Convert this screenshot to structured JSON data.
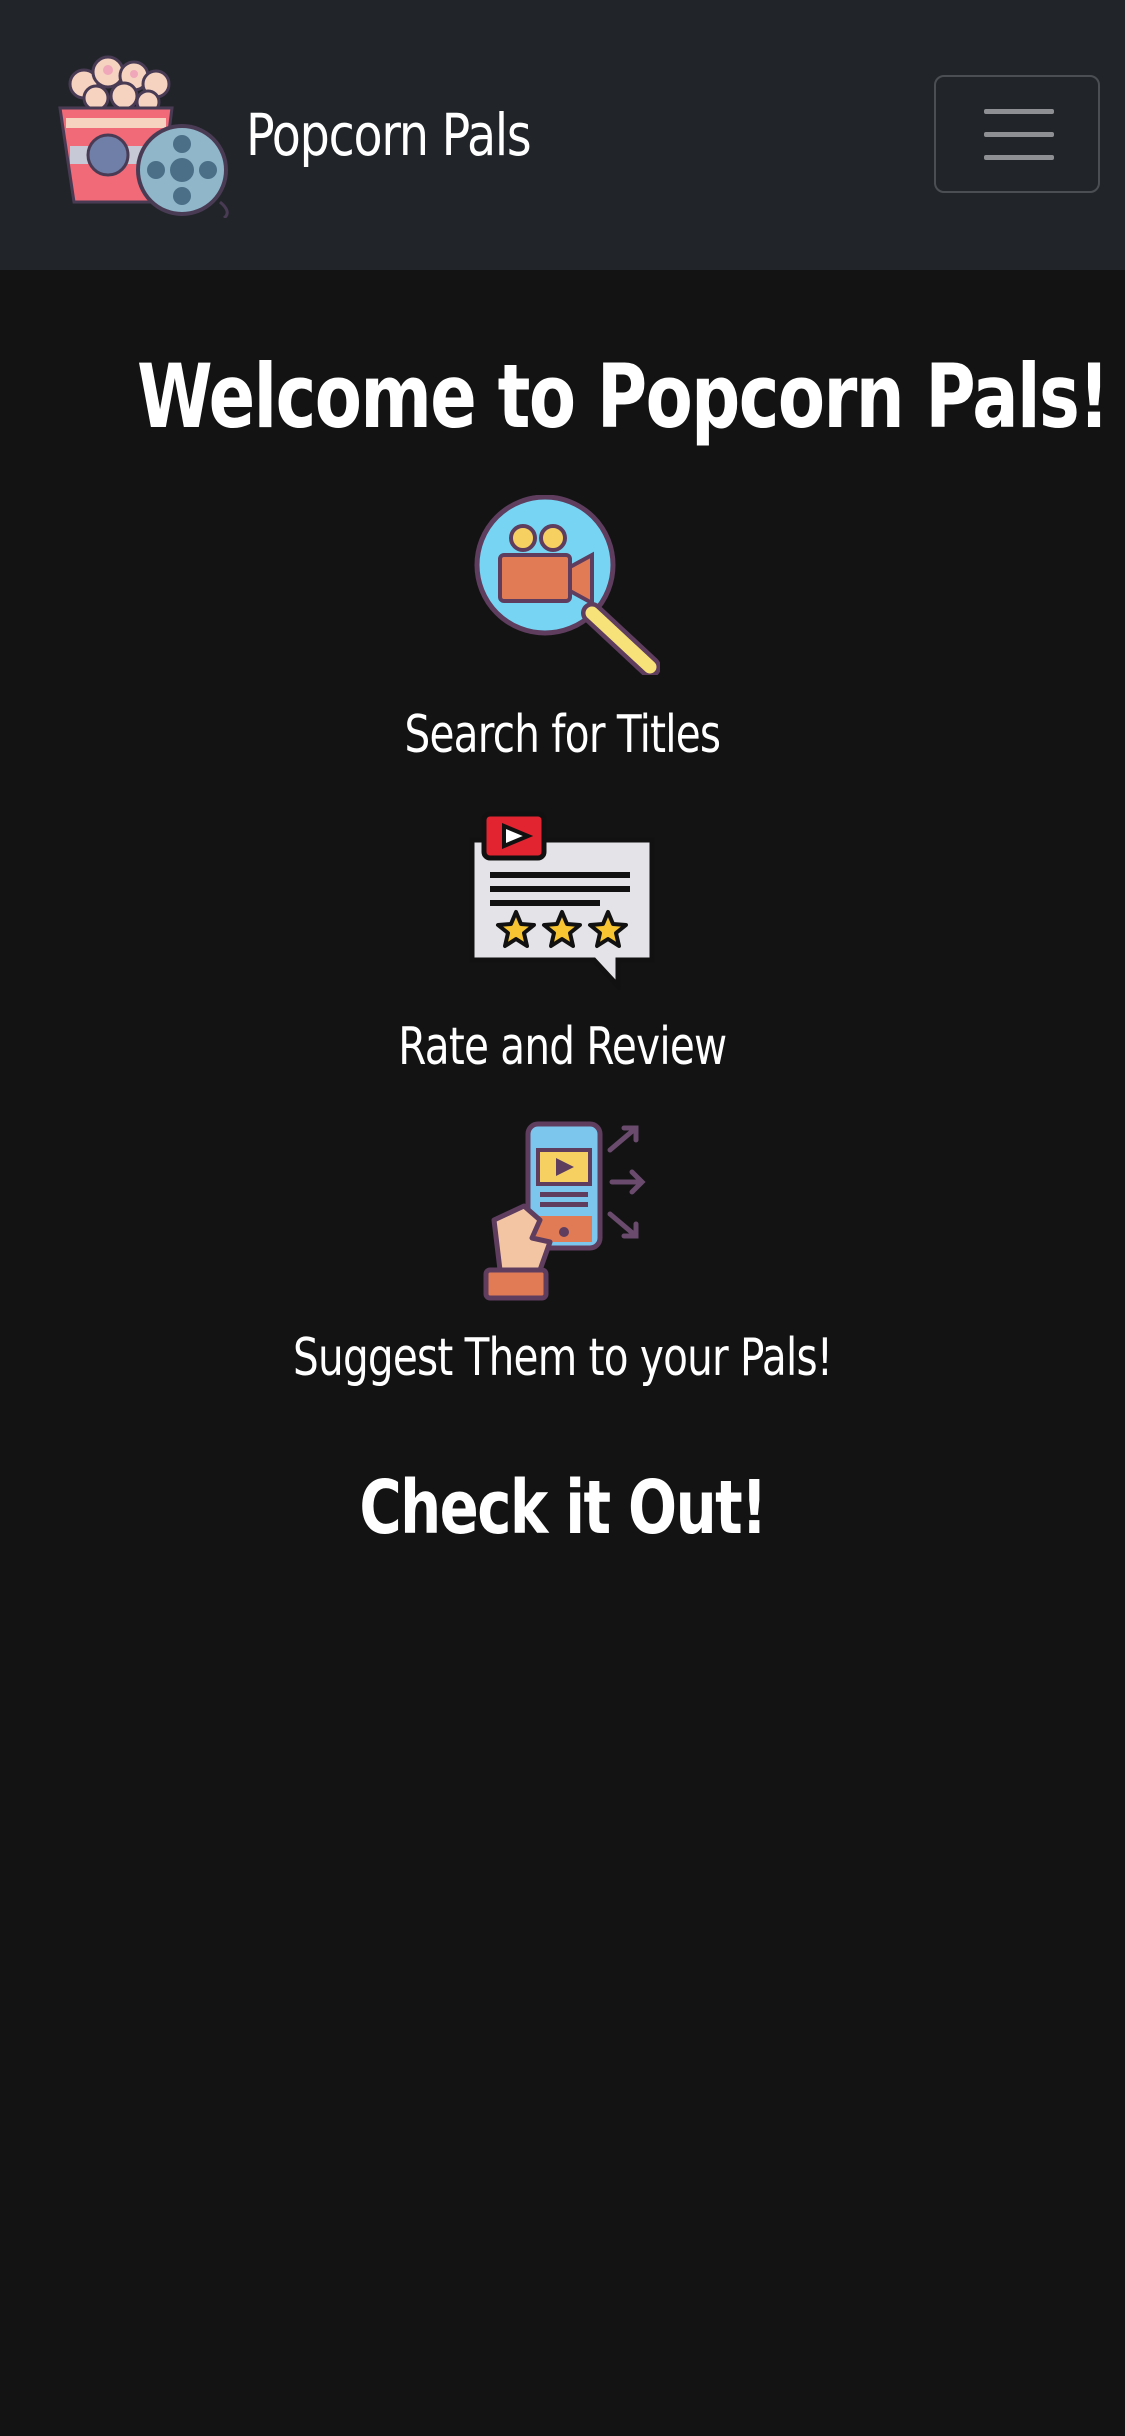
{
  "navbar": {
    "brand_name": "Popcorn Pals",
    "brand_icon": "popcorn-film-reel-icon",
    "menu_icon": "hamburger-menu-icon"
  },
  "main": {
    "title": "Welcome to Popcorn Pals!",
    "features": [
      {
        "icon": "search-camera-icon",
        "label": "Search for Titles"
      },
      {
        "icon": "rating-review-icon",
        "label": "Rate and Review"
      },
      {
        "icon": "share-phone-icon",
        "label": "Suggest Them to your Pals!"
      }
    ],
    "cta": "Check it Out!"
  },
  "colors": {
    "page_background": "#131313",
    "navbar_background": "#212529",
    "text": "#ffffff"
  }
}
